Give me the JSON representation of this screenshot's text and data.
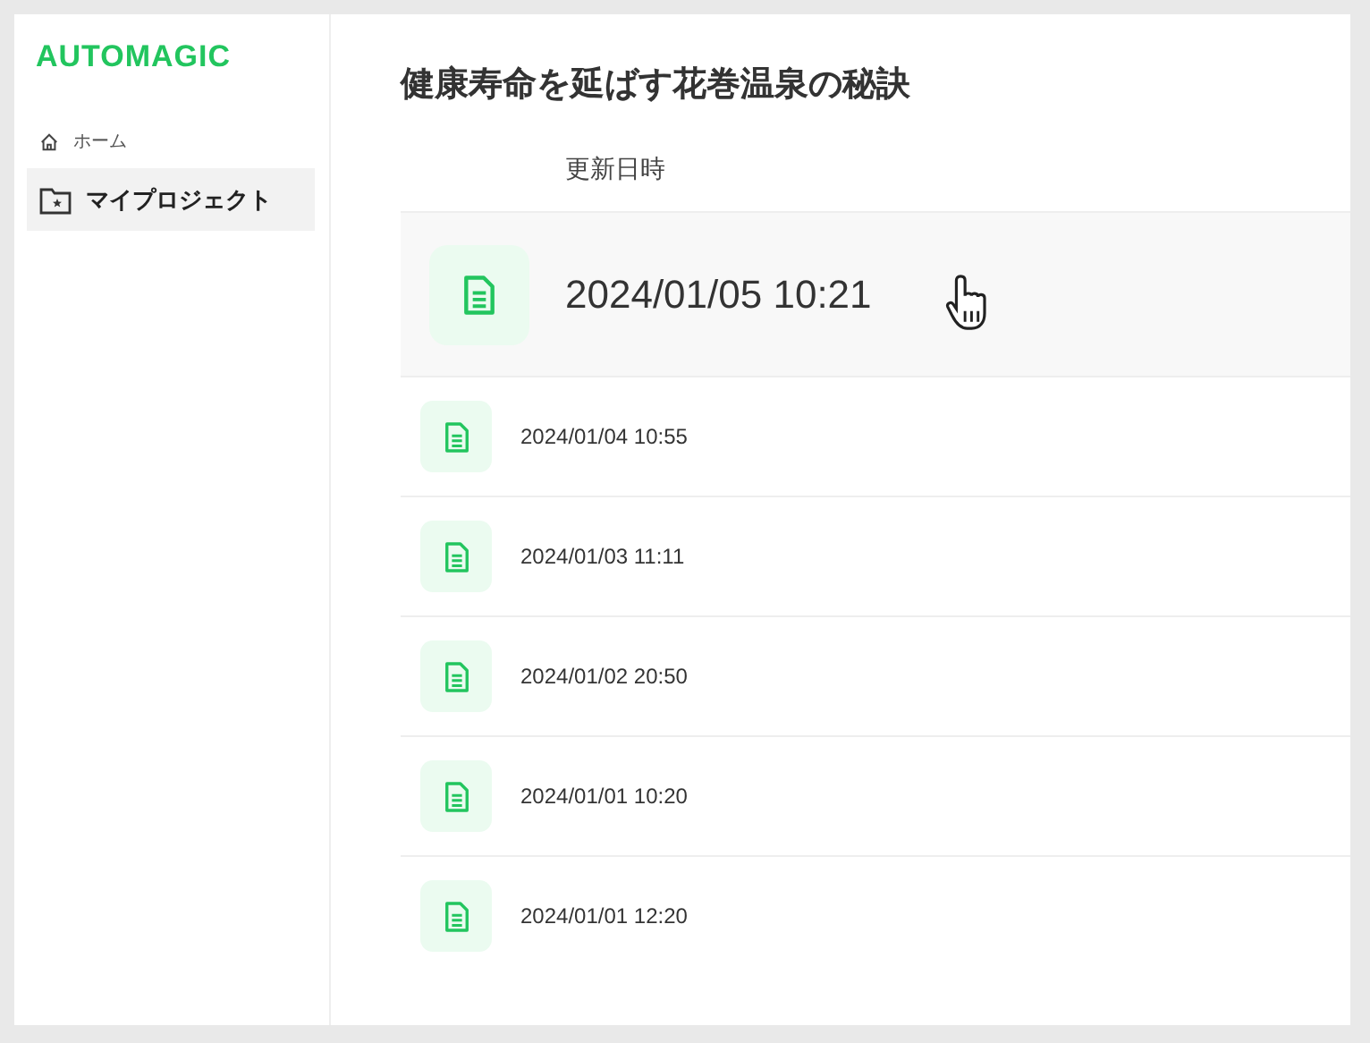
{
  "sidebar": {
    "logo": "AUTOMAGIC",
    "items": [
      {
        "label": "ホーム",
        "kind": "home",
        "selected": false
      },
      {
        "label": "マイプロジェクト",
        "kind": "project",
        "selected": true
      }
    ]
  },
  "main": {
    "title": "健康寿命を延ばす花巻温泉の秘訣",
    "table": {
      "columns": [
        "更新日時"
      ],
      "rows": [
        {
          "updated": "2024/01/05 10:21",
          "highlighted": true
        },
        {
          "updated": "2024/01/04 10:55",
          "highlighted": false
        },
        {
          "updated": "2024/01/03 11:11",
          "highlighted": false
        },
        {
          "updated": "2024/01/02 20:50",
          "highlighted": false
        },
        {
          "updated": "2024/01/01 10:20",
          "highlighted": false
        },
        {
          "updated": "2024/01/01 12:20",
          "highlighted": false
        }
      ]
    }
  }
}
